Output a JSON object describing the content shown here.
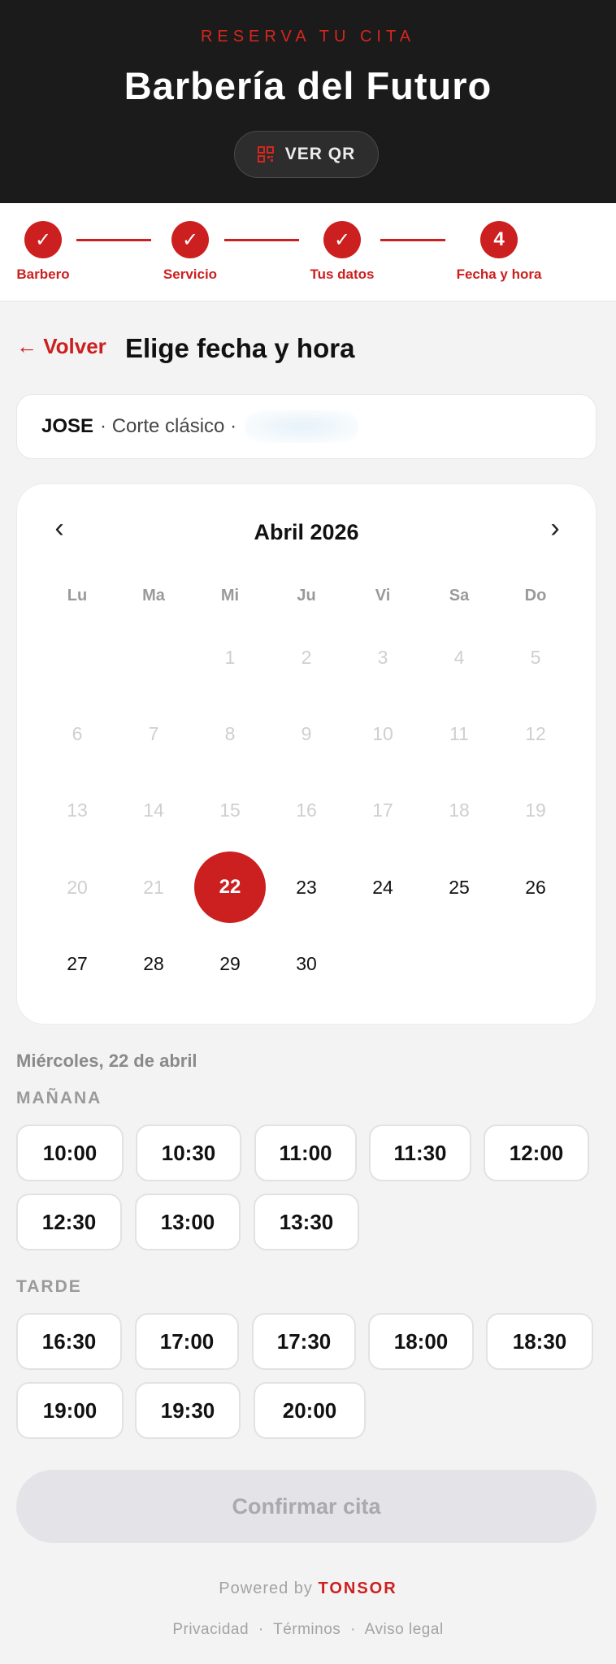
{
  "header": {
    "eyebrow": "RESERVA TU CITA",
    "title": "Barbería del Futuro",
    "qr_button": "VER QR",
    "accent_color": "#cc1f1f"
  },
  "stepper": {
    "steps": [
      {
        "label": "Barbero",
        "symbol": "✓",
        "state": "done"
      },
      {
        "label": "Servicio",
        "symbol": "✓",
        "state": "done"
      },
      {
        "label": "Tus datos",
        "symbol": "✓",
        "state": "done"
      },
      {
        "label": "Fecha y hora",
        "symbol": "4",
        "state": "current"
      }
    ]
  },
  "nav": {
    "back_label": "← Volver",
    "page_title": "Elige fecha y hora"
  },
  "summary": {
    "barber": "JOSE",
    "service": "· Corte clásico ·"
  },
  "calendar": {
    "month_label": "Abril 2026",
    "prev_icon": "‹",
    "next_icon": "›",
    "weekdays": [
      "Lu",
      "Ma",
      "Mi",
      "Ju",
      "Vi",
      "Sa",
      "Do"
    ],
    "days": [
      "1",
      "2",
      "3",
      "4",
      "5",
      "6",
      "7",
      "8",
      "9",
      "10",
      "11",
      "12",
      "13",
      "14",
      "15",
      "16",
      "17",
      "18",
      "19",
      "20",
      "21",
      "22",
      "23",
      "24",
      "25",
      "26",
      "27",
      "28",
      "29",
      "30"
    ],
    "disabled_through": 21,
    "selected": "22"
  },
  "slots": {
    "date_label": "Miércoles, 22 de abril",
    "morning_label": "MAÑANA",
    "morning": [
      "10:00",
      "10:30",
      "11:00",
      "11:30",
      "12:00",
      "12:30",
      "13:00",
      "13:30"
    ],
    "afternoon_label": "TARDE",
    "afternoon": [
      "16:30",
      "17:00",
      "17:30",
      "18:00",
      "18:30",
      "19:00",
      "19:30",
      "20:00"
    ]
  },
  "confirm_label": "Confirmar cita",
  "footer": {
    "powered_prefix": "Powered by",
    "brand": "TONSOR",
    "links": [
      "Privacidad",
      "Términos",
      "Aviso legal"
    ],
    "separator": "·"
  }
}
